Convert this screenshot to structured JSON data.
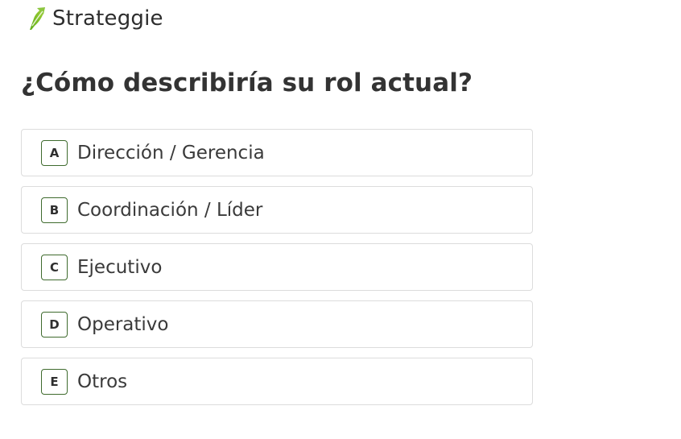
{
  "brand": {
    "name": "Strateggie",
    "logo_icon": "leaf-arrow-icon",
    "accent_color": "#7bbf1e"
  },
  "question": {
    "title": "¿Cómo describiría su rol actual?"
  },
  "options": [
    {
      "key": "A",
      "label": "Dirección / Gerencia"
    },
    {
      "key": "B",
      "label": "Coordinación / Líder"
    },
    {
      "key": "C",
      "label": "Ejecutivo"
    },
    {
      "key": "D",
      "label": "Operativo"
    },
    {
      "key": "E",
      "label": "Otros"
    }
  ],
  "colors": {
    "key_border": "#3f6b2e",
    "option_border": "#dcdcdc",
    "text": "#333333"
  }
}
